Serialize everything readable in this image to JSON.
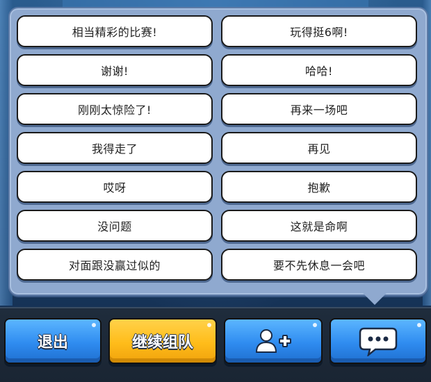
{
  "phrases": {
    "left": [
      "相当精彩的比赛!",
      "谢谢!",
      "刚刚太惊险了!",
      "我得走了",
      "哎呀",
      "没问题",
      "对面跟没赢过似的"
    ],
    "right": [
      "玩得挺6啊!",
      "哈哈!",
      "再来一场吧",
      "再见",
      "抱歉",
      "这就是命啊",
      "要不先休息一会吧"
    ]
  },
  "footer": {
    "exit_label": "退出",
    "continue_label": "继续组队",
    "add_friend_icon": "add-friend-icon",
    "chat_icon": "chat-bubble-icon"
  },
  "colors": {
    "panel": "#8fa9cf",
    "button_blue": "#2f8cf0",
    "button_yellow": "#ffbc1a"
  }
}
